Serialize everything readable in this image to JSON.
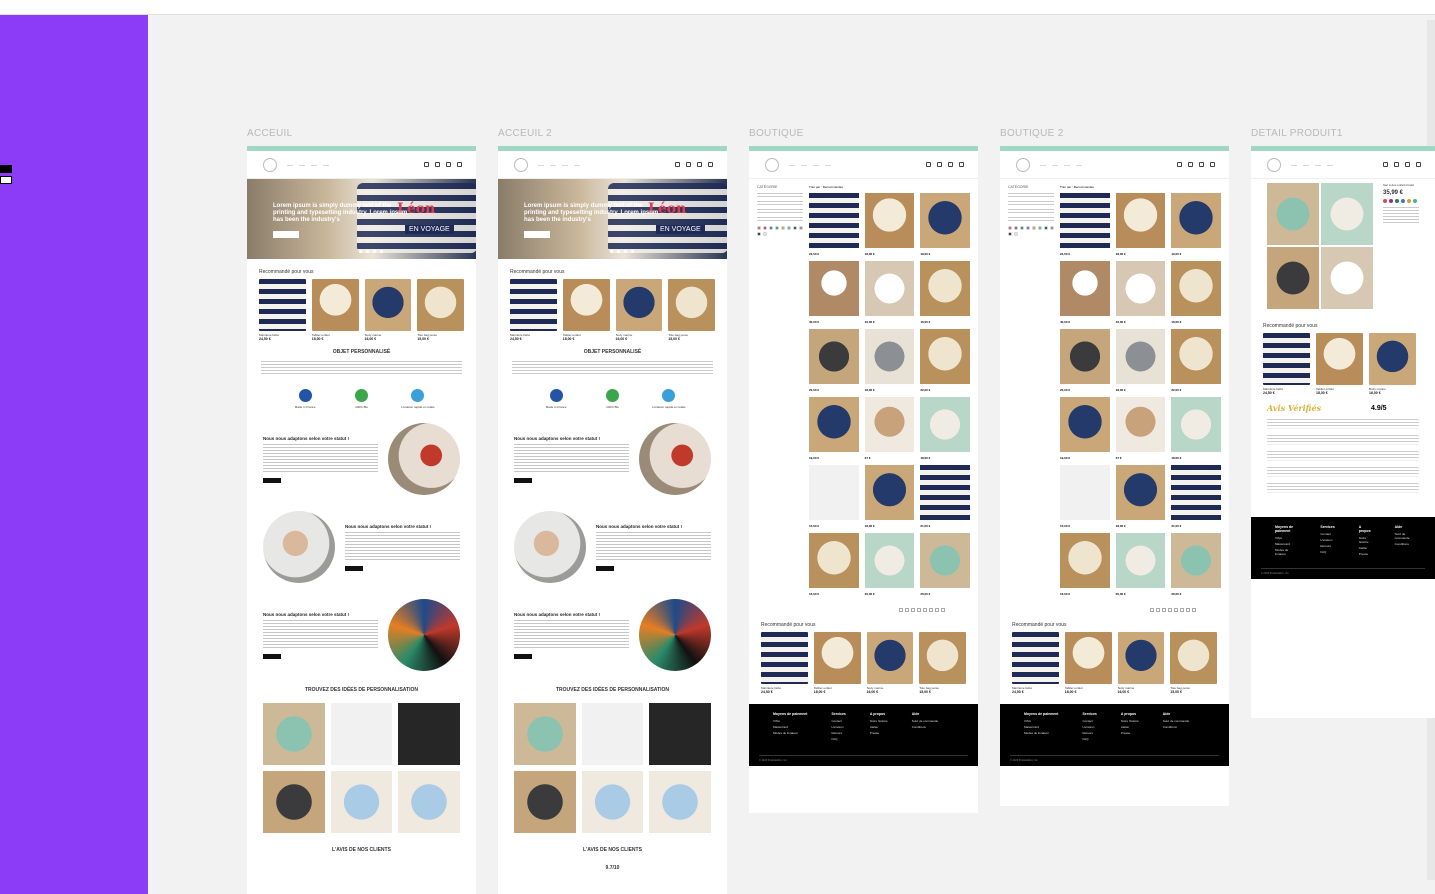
{
  "frames": [
    {
      "label": "ACCEUIL"
    },
    {
      "label": "ACCEUIL 2"
    },
    {
      "label": "BOUTIQUE"
    },
    {
      "label": "BOUTIQUE 2"
    },
    {
      "label": "DETAIL PRODUIT1"
    }
  ],
  "hero": {
    "tagline": "Lorem ipsum is simply dummy text of the printing and typesetting industry. Lorem ipsum has been the industry's",
    "brand": "Léon",
    "sub": "EN VOYAGE"
  },
  "sections": {
    "recommended": "Recommandé pour vous",
    "personalized": "OBJET PERSONNALISÉ",
    "adapt": "Nous nous adaptons selon votre statut !",
    "ideas": "TROUVEZ DES IDÉES DE PERSONNALISATION",
    "client_reviews": "L'AVIS DE NOS CLIENTS",
    "rating_home2": "9.7/10"
  },
  "features": [
    {
      "label": "Made in France",
      "color": "#2355a6"
    },
    {
      "label": "100% Bio",
      "color": "#3aa64b"
    },
    {
      "label": "Livraison rapide en relais",
      "color": "#3aa0d8"
    }
  ],
  "products": [
    {
      "title": "Marinière bébé",
      "price": "24,50 €",
      "img": "img-stripe"
    },
    {
      "title": "Tablier enfant",
      "price": "18,00 €",
      "img": "img-apron"
    },
    {
      "title": "Body marine",
      "price": "16,00 €",
      "img": "img-navy"
    },
    {
      "title": "Tote bag perso",
      "price": "15,00 €",
      "img": "img-tote"
    }
  ],
  "shop_products": [
    {
      "img": "img-stripe",
      "price": "24,50 €"
    },
    {
      "img": "img-apron",
      "price": "18,00 €"
    },
    {
      "img": "img-navy",
      "price": "19,00 €"
    },
    {
      "img": "img-doll",
      "price": "40,00 €"
    },
    {
      "img": "img-body",
      "price": "16,00 €"
    },
    {
      "img": "img-tote",
      "price": "16,00 €"
    },
    {
      "img": "img-tshirt-dark",
      "price": "20,00 €"
    },
    {
      "img": "img-tshirt-grey",
      "price": "18,00 €"
    },
    {
      "img": "img-tote",
      "price": "22,00 €"
    },
    {
      "img": "img-navy",
      "price": "19,00 €"
    },
    {
      "img": "img-bear",
      "price": "37 €"
    },
    {
      "img": "img-pastel",
      "price": "18,00 €"
    },
    {
      "img": "img-white",
      "price": "15,00 €"
    },
    {
      "img": "img-navy",
      "price": "18,00 €"
    },
    {
      "img": "img-stripe",
      "price": "21,00 €"
    },
    {
      "img": "img-tote",
      "price": "16,00 €"
    },
    {
      "img": "img-pastel",
      "price": "20,00 €"
    },
    {
      "img": "img-green",
      "price": "26,00 €"
    }
  ],
  "shop": {
    "categories": "CATÉGORIE",
    "sort": "Trier par : Recommandés",
    "colors": [
      "#e04a4a",
      "#9c2f7a",
      "#2c7a5e",
      "#3a79c4",
      "#d4a12a",
      "#4bb3a1",
      "#1e2a55",
      "#8a8a8a",
      "#111111",
      "#f0f0f0"
    ]
  },
  "footer": {
    "cols": [
      {
        "title": "Moyens de paiement",
        "items": [
          "VISA",
          "Mastercard",
          "Modes de livraison"
        ]
      },
      {
        "title": "Services",
        "items": [
          "Contact",
          "Livraison",
          "Retours",
          "FAQ"
        ]
      },
      {
        "title": "A propos",
        "items": [
          "Notre histoire",
          "Atelier",
          "Presse"
        ]
      },
      {
        "title": "Aide",
        "items": [
          "Suivi de commande",
          "Conditions"
        ]
      }
    ],
    "copyright": "© 2023 Poulette&Co, Inc."
  },
  "detail": {
    "title": "Sac à dos enfant brodé",
    "price": "35,99 €",
    "reviews_brand": "Avis Vérifiés",
    "score": "4.9/5"
  }
}
